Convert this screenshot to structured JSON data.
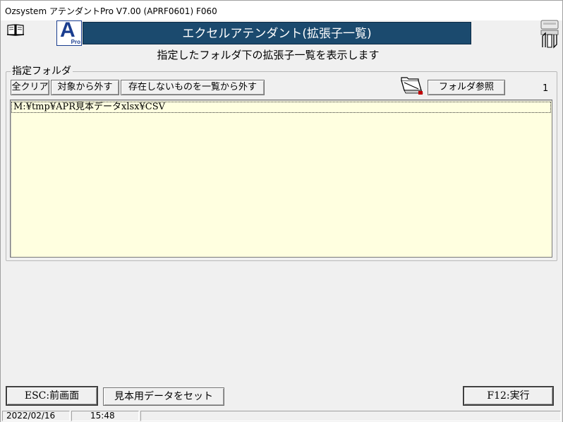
{
  "window": {
    "title": "Ozsystem アテンダントPro V7.00 (APRF0601)  F060"
  },
  "logo": {
    "letter": "A",
    "sub": "Pro"
  },
  "header": {
    "banner": "エクセルアテンダント(拡張子一覧)",
    "subtitle": "指定したフォルダ下の拡張子一覧を表示します"
  },
  "folder_group": {
    "legend": "指定フォルダ",
    "buttons": {
      "all_clear": "全クリア",
      "exclude": "対象から外す",
      "exclude_missing": "存在しないものを一覧から外す",
      "browse": "フォルダ参照"
    },
    "count": "1",
    "items": [
      "M:¥tmp¥APR見本データxlsx¥CSV"
    ]
  },
  "footer": {
    "esc_label": "ESC:前画面",
    "sample_label": "見本用データをセット",
    "f12_label": "F12:実行"
  },
  "status": {
    "date": "2022/02/16",
    "time": "15:48"
  },
  "colors": {
    "banner_bg": "#1b4a6e",
    "list_bg": "#ffffe0",
    "logo_blue": "#1a3d8f",
    "window_bg": "#f0f0f0"
  },
  "icons": [
    "book-icon",
    "app-logo",
    "clipboard-icon",
    "folder-browse-icon"
  ]
}
